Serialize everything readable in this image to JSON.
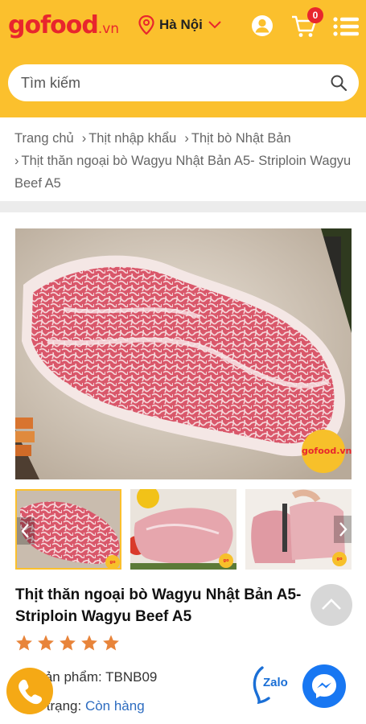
{
  "header": {
    "logo_go": "go",
    "logo_food": "food",
    "logo_vn": ".vn",
    "location": "Hà Nội",
    "cart_count": "0",
    "bg_color": "#fbc02d"
  },
  "search": {
    "placeholder": "Tìm kiếm"
  },
  "breadcrumb": {
    "items": [
      "Trang chủ",
      "Thịt nhập khẩu",
      "Thịt bò Nhật Bản",
      "Thịt thăn ngoại bò Wagyu Nhật Bản A5- Striploin Wagyu Beef A5"
    ]
  },
  "product": {
    "image_badge": "gofood.vn",
    "title": "Thịt thăn ngoại bò Wagyu Nhật Bản A5- Striploin Wagyu Beef A5",
    "rating": 5,
    "sku_label": "Mã sản phẩm: ",
    "sku": "TBNB09",
    "stock_label": "Tình trạng: ",
    "stock": "Còn hàng"
  },
  "contact": {
    "zalo": "Zalo"
  },
  "icons": {
    "location": "location-pin-icon",
    "user": "user-icon",
    "cart": "cart-icon",
    "menu": "menu-icon",
    "search": "search-icon",
    "phone": "phone-icon",
    "messenger": "messenger-icon"
  }
}
